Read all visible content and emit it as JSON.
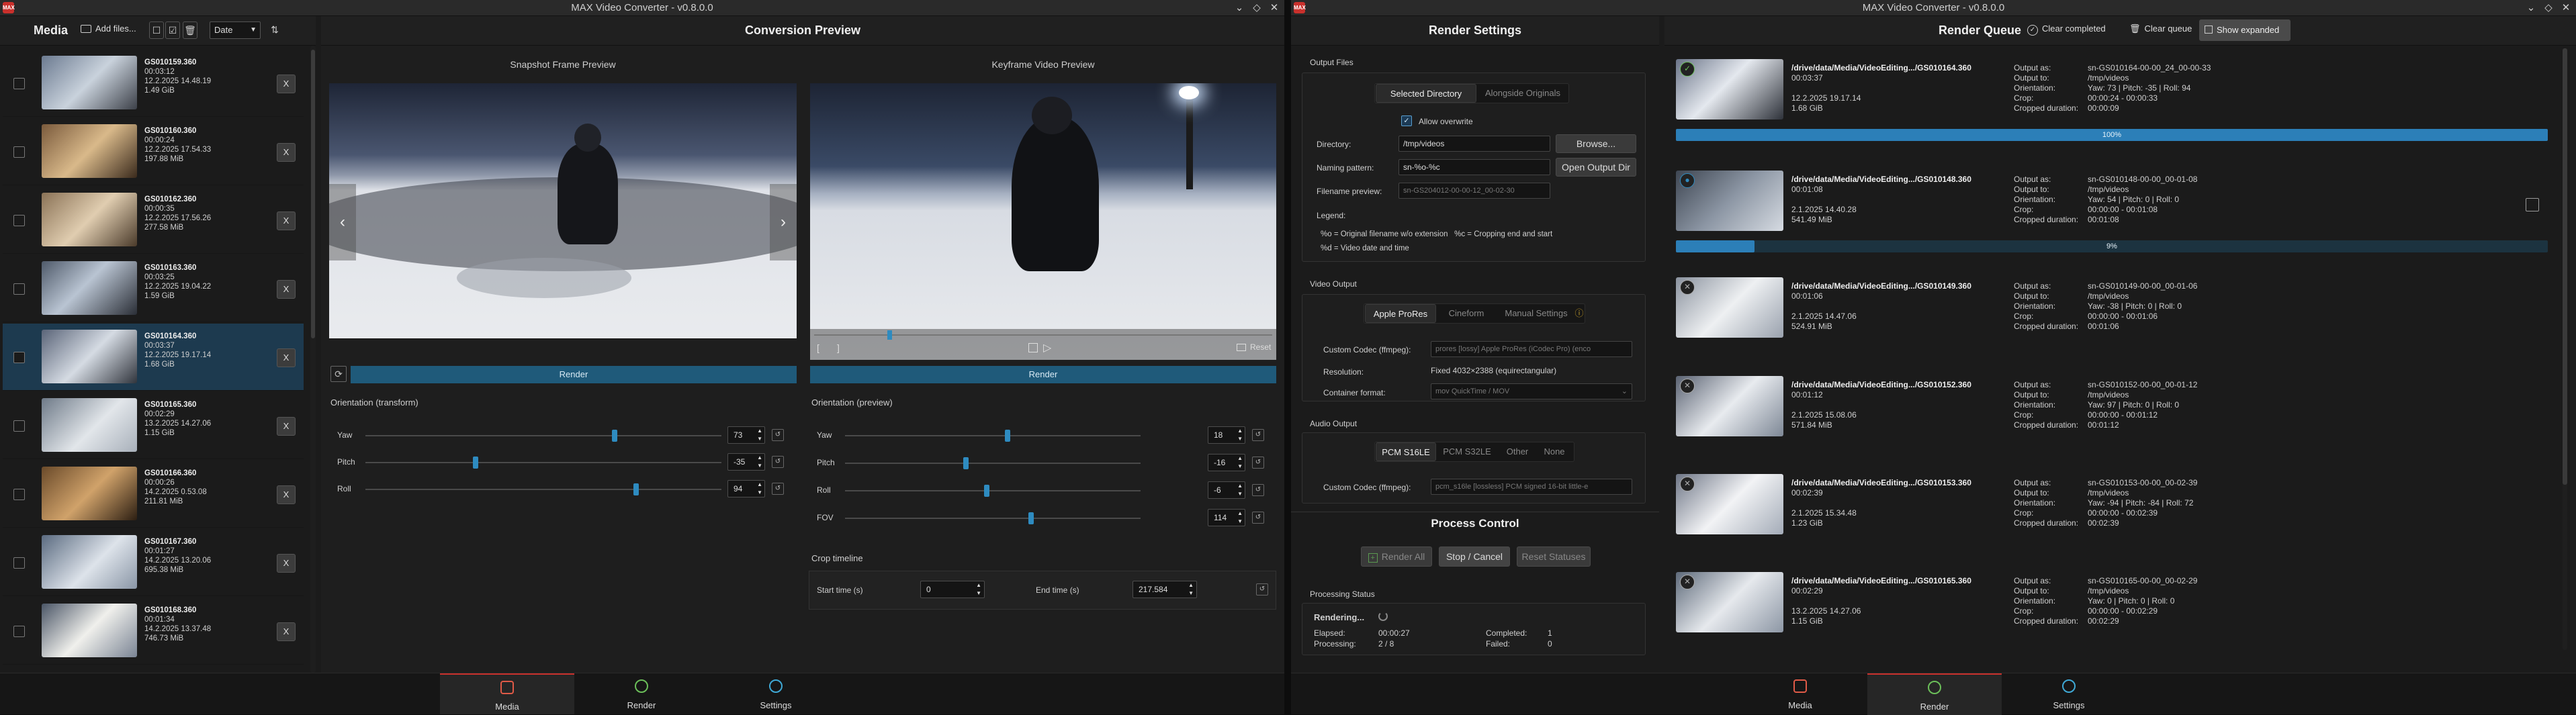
{
  "left_window": {
    "title": "MAX Video Converter - v0.8.0.0",
    "logo": "MAX",
    "media": {
      "title": "Media",
      "add_files": "Add files...",
      "sort_value": "Date",
      "items": [
        {
          "name": "GS010159.360",
          "duration": "00:03:12",
          "date": "12.2.2025 14.48.19",
          "size": "1.49 GiB",
          "selected": false
        },
        {
          "name": "GS010160.360",
          "duration": "00:00:24",
          "date": "12.2.2025 17.54.33",
          "size": "197.88 MiB",
          "selected": false
        },
        {
          "name": "GS010162.360",
          "duration": "00:00:35",
          "date": "12.2.2025 17.56.26",
          "size": "277.58 MiB",
          "selected": false
        },
        {
          "name": "GS010163.360",
          "duration": "00:03:25",
          "date": "12.2.2025 19.04.22",
          "size": "1.59 GiB",
          "selected": false
        },
        {
          "name": "GS010164.360",
          "duration": "00:03:37",
          "date": "12.2.2025 19.17.14",
          "size": "1.68 GiB",
          "selected": true
        },
        {
          "name": "GS010165.360",
          "duration": "00:02:29",
          "date": "13.2.2025 14.27.06",
          "size": "1.15 GiB",
          "selected": false
        },
        {
          "name": "GS010166.360",
          "duration": "00:00:26",
          "date": "14.2.2025 0.53.08",
          "size": "211.81 MiB",
          "selected": false
        },
        {
          "name": "GS010167.360",
          "duration": "00:01:27",
          "date": "14.2.2025 13.20.06",
          "size": "695.38 MiB",
          "selected": false
        },
        {
          "name": "GS010168.360",
          "duration": "00:01:34",
          "date": "14.2.2025 13.37.48",
          "size": "746.73 MiB",
          "selected": false
        }
      ],
      "remove_label": "X"
    },
    "preview": {
      "title": "Conversion Preview",
      "snapshot_title": "Snapshot Frame Preview",
      "keyframe_title": "Keyframe Video Preview",
      "render_label": "Render",
      "reset_label": "Reset",
      "orientation_transform": "Orientation (transform)",
      "orientation_preview": "Orientation (preview)",
      "transform": [
        {
          "label": "Yaw",
          "value": "73",
          "fraction": 0.7
        },
        {
          "label": "Pitch",
          "value": "-35",
          "fraction": 0.31
        },
        {
          "label": "Roll",
          "value": "94",
          "fraction": 0.76
        }
      ],
      "preview_params": [
        {
          "label": "Yaw",
          "value": "18",
          "fraction": 0.55
        },
        {
          "label": "Pitch",
          "value": "-16",
          "fraction": 0.41
        },
        {
          "label": "Roll",
          "value": "-6",
          "fraction": 0.48
        },
        {
          "label": "FOV",
          "value": "114",
          "fraction": 0.63
        }
      ],
      "crop_title": "Crop timeline",
      "start_label": "Start time (s)",
      "start_value": "0",
      "end_label": "End time (s)",
      "end_value": "217.584"
    },
    "tabs": [
      {
        "label": "Media",
        "active": true
      },
      {
        "label": "Render",
        "active": false
      },
      {
        "label": "Settings",
        "active": false
      }
    ]
  },
  "right_window": {
    "title": "MAX Video Converter - v0.8.0.0",
    "logo": "MAX",
    "render_settings": {
      "title": "Render Settings",
      "output_files": "Output Files",
      "seg_output": [
        "Selected Directory",
        "Alongside Originals"
      ],
      "allow_overwrite": "Allow overwrite",
      "directory_label": "Directory:",
      "directory_value": "/tmp/videos",
      "browse": "Browse...",
      "naming_label": "Naming pattern:",
      "naming_value": "sn-%o-%c",
      "open_output": "Open Output Dir",
      "filename_preview_label": "Filename preview:",
      "filename_preview_value": "sn-GS204012-00-00-12_00-02-30",
      "legend_label": "Legend:",
      "legend_line1": "%o = Original filename w/o extension   %c = Cropping end and start",
      "legend_line2": "%d = Video date and time",
      "video_output": "Video Output",
      "seg_video": [
        "Apple ProRes",
        "Cineform",
        "Manual Settings"
      ],
      "custom_codec_label": "Custom Codec (ffmpeg):",
      "custom_codec_value": "prores  [lossy] Apple ProRes (iCodec Pro) (enco",
      "resolution_label": "Resolution:",
      "resolution_value": "Fixed 4032×2388 (equirectangular)",
      "container_label": "Container format:",
      "container_value": "mov  QuickTime / MOV",
      "audio_output": "Audio Output",
      "seg_audio": [
        "PCM S16LE",
        "PCM S32LE",
        "Other",
        "None"
      ],
      "audio_codec_label": "Custom Codec (ffmpeg):",
      "audio_codec_value": "pcm_s16le  [lossless] PCM signed 16-bit little-e"
    },
    "process_control": {
      "title": "Process Control",
      "render_all": "Render All",
      "stop_cancel": "Stop / Cancel",
      "reset_statuses": "Reset Statuses",
      "status_title": "Processing Status",
      "state": "Rendering...",
      "elapsed_label": "Elapsed:",
      "elapsed_value": "00:00:27",
      "processing_label": "Processing:",
      "processing_value": "2 / 8",
      "completed_label": "Completed:",
      "completed_value": "1",
      "failed_label": "Failed:",
      "failed_value": "0"
    },
    "queue": {
      "title": "Render Queue",
      "clear_completed": "Clear completed",
      "clear_queue": "Clear queue",
      "show_expanded": "Show expanded",
      "meta_labels": [
        "Output as:",
        "Output to:",
        "Orientation:",
        "Crop:",
        "Cropped duration:"
      ],
      "items": [
        {
          "path": "/drive/data/Media/VideoEditing.../GS010164.360",
          "duration": "00:03:37",
          "date": "12.2.2025 19.17.14",
          "size": "1.68 GiB",
          "output_as": "sn-GS010164-00-00_24_00-00-33",
          "output_to": "/tmp/videos",
          "orientation": "Yaw: 73 | Pitch: -35 | Roll: 94",
          "crop": "00:00:24 - 00:00:33",
          "cropped": "00:00:09",
          "status": "done",
          "progress": 1.0,
          "progress_label": "100%"
        },
        {
          "path": "/drive/data/Media/VideoEditing.../GS010148.360",
          "duration": "00:01:08",
          "date": "2.1.2025 14.40.28",
          "size": "541.49 MiB",
          "output_as": "sn-GS010148-00-00_00-01-08",
          "output_to": "/tmp/videos",
          "orientation": "Yaw: 54 | Pitch: 0 | Roll: 0",
          "crop": "00:00:00 - 00:01:08",
          "cropped": "00:01:08",
          "status": "processing",
          "progress": 0.09,
          "progress_label": "9%"
        },
        {
          "path": "/drive/data/Media/VideoEditing.../GS010149.360",
          "duration": "00:01:06",
          "date": "2.1.2025 14.47.06",
          "size": "524.91 MiB",
          "output_as": "sn-GS010149-00-00_00-01-06",
          "output_to": "/tmp/videos",
          "orientation": "Yaw: -38 | Pitch: 0 | Roll: 0",
          "crop": "00:00:00 - 00:01:06",
          "cropped": "00:01:06",
          "status": "queued"
        },
        {
          "path": "/drive/data/Media/VideoEditing.../GS010152.360",
          "duration": "00:01:12",
          "date": "2.1.2025 15.08.06",
          "size": "571.84 MiB",
          "output_as": "sn-GS010152-00-00_00-01-12",
          "output_to": "/tmp/videos",
          "orientation": "Yaw: 97 | Pitch: 0 | Roll: 0",
          "crop": "00:00:00 - 00:01:12",
          "cropped": "00:01:12",
          "status": "queued"
        },
        {
          "path": "/drive/data/Media/VideoEditing.../GS010153.360",
          "duration": "00:02:39",
          "date": "2.1.2025 15.34.48",
          "size": "1.23 GiB",
          "output_as": "sn-GS010153-00-00_00-02-39",
          "output_to": "/tmp/videos",
          "orientation": "Yaw: -94 | Pitch: -84 | Roll: 72",
          "crop": "00:00:00 - 00:02:39",
          "cropped": "00:02:39",
          "status": "queued"
        },
        {
          "path": "/drive/data/Media/VideoEditing.../GS010165.360",
          "duration": "00:02:29",
          "date": "13.2.2025 14.27.06",
          "size": "1.15 GiB",
          "output_as": "sn-GS010165-00-00_00-02-29",
          "output_to": "/tmp/videos",
          "orientation": "Yaw: 0 | Pitch: 0 | Roll: 0",
          "crop": "00:00:00 - 00:02:29",
          "cropped": "00:02:29",
          "status": "queued"
        }
      ]
    },
    "tabs": [
      {
        "label": "Media",
        "active": false
      },
      {
        "label": "Render",
        "active": true
      },
      {
        "label": "Settings",
        "active": false
      }
    ]
  },
  "colors": {
    "accent": "#2e8bc0",
    "brand": "#c9302c",
    "selected_row": "#1d3a4f"
  }
}
